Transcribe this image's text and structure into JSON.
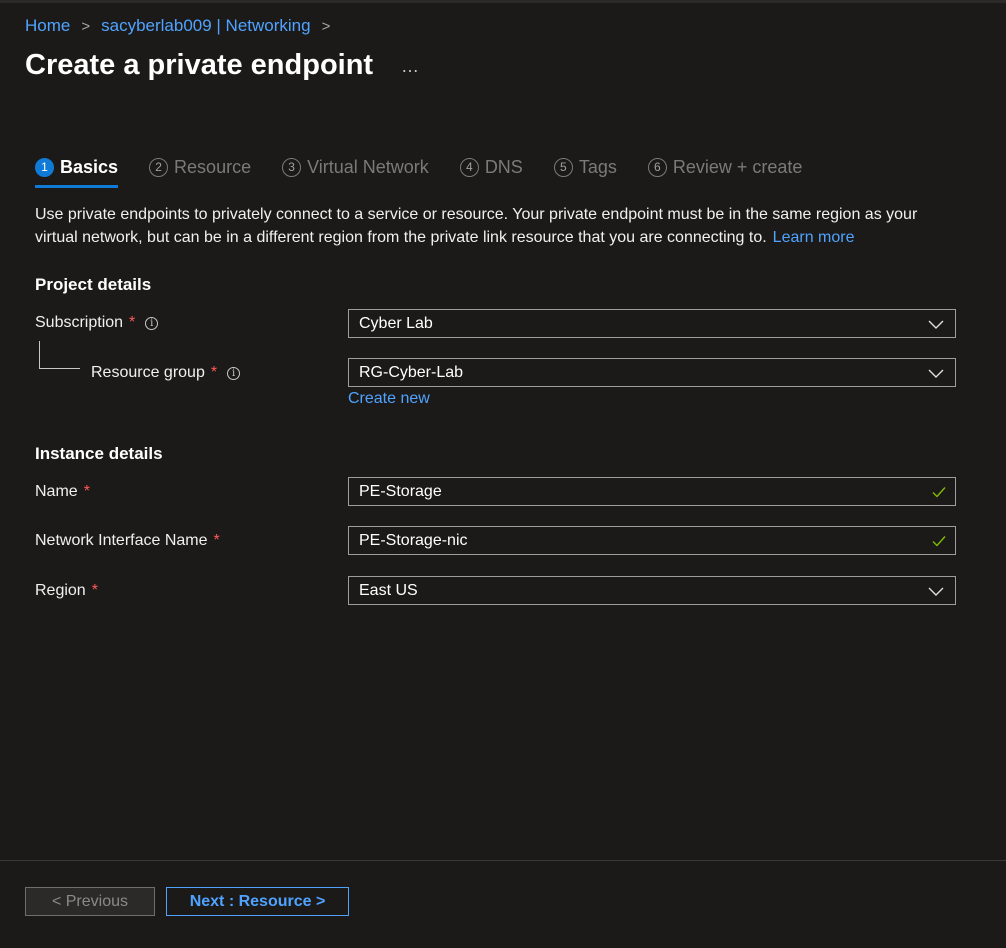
{
  "breadcrumb": {
    "home": "Home",
    "parent": "sacyberlab009 | Networking",
    "separator": ">"
  },
  "page": {
    "title": "Create a private endpoint",
    "more": "…"
  },
  "tabs": [
    {
      "num": "1",
      "label": "Basics",
      "active": true
    },
    {
      "num": "2",
      "label": "Resource",
      "active": false
    },
    {
      "num": "3",
      "label": "Virtual Network",
      "active": false
    },
    {
      "num": "4",
      "label": "DNS",
      "active": false
    },
    {
      "num": "5",
      "label": "Tags",
      "active": false
    },
    {
      "num": "6",
      "label": "Review + create",
      "active": false
    }
  ],
  "description": {
    "text": "Use private endpoints to privately connect to a service or resource. Your private endpoint must be in the same region as your virtual network, but can be in a different region from the private link resource that you are connecting to.",
    "link": "Learn more"
  },
  "project": {
    "title": "Project details",
    "subscription": {
      "label": "Subscription",
      "required": "*",
      "info": "i",
      "value": "Cyber Lab"
    },
    "resource_group": {
      "label": "Resource group",
      "required": "*",
      "info": "i",
      "value": "RG-Cyber-Lab",
      "create_new": "Create new"
    }
  },
  "instance": {
    "title": "Instance details",
    "name": {
      "label": "Name",
      "required": "*",
      "value": "PE-Storage"
    },
    "nic": {
      "label": "Network Interface Name",
      "required": "*",
      "value": "PE-Storage-nic"
    },
    "region": {
      "label": "Region",
      "required": "*",
      "value": "East US"
    }
  },
  "footer": {
    "previous": "< Previous",
    "next": "Next : Resource >"
  },
  "colors": {
    "accent": "#0f7bd6",
    "link": "#4fa3ff",
    "required": "#ff5a5a",
    "valid": "#7fba00",
    "background": "#1b1a19"
  },
  "icons": {
    "dropdown": "chevron-down-icon",
    "valid": "checkmark-icon",
    "info": "info-icon"
  }
}
